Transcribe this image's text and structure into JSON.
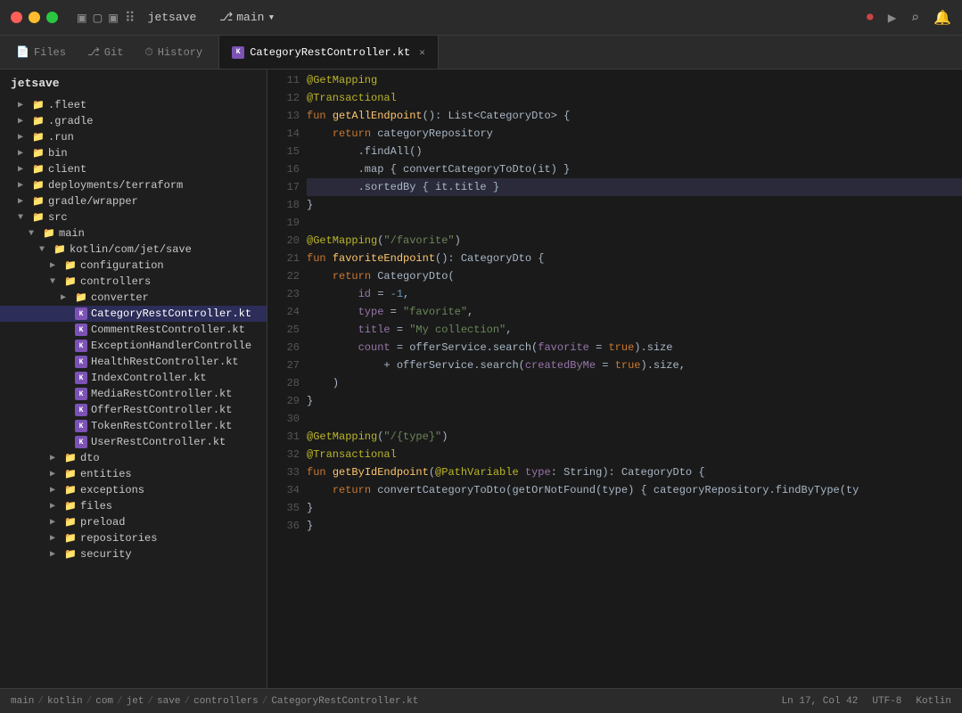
{
  "titlebar": {
    "app_name": "jetsave",
    "branch_icon": "⎇",
    "branch_name": "main",
    "branch_chevron": "▾",
    "icons": [
      "▣",
      "▢",
      "⊞",
      "⠿"
    ],
    "right_icons": {
      "record": "⏺",
      "run": "▶",
      "search": "⌕",
      "bell": "🔔"
    }
  },
  "tabs": {
    "nav": [
      {
        "label": "Files",
        "icon": "📄"
      },
      {
        "label": "Git",
        "icon": "⎇"
      },
      {
        "label": "History",
        "icon": "⏱"
      }
    ],
    "files": [
      {
        "label": "CategoryRestController.kt",
        "active": true
      }
    ]
  },
  "sidebar": {
    "project_name": "jetsave",
    "tree": [
      {
        "label": ".fleet",
        "indent": 1,
        "type": "folder",
        "chevron": "▶",
        "expanded": false
      },
      {
        "label": ".gradle",
        "indent": 1,
        "type": "folder",
        "chevron": "▶",
        "expanded": false
      },
      {
        "label": ".run",
        "indent": 1,
        "type": "folder",
        "chevron": "▶",
        "expanded": false
      },
      {
        "label": "bin",
        "indent": 1,
        "type": "folder",
        "chevron": "▶",
        "expanded": false
      },
      {
        "label": "client",
        "indent": 1,
        "type": "folder",
        "chevron": "▶",
        "expanded": false
      },
      {
        "label": "deployments/terraform",
        "indent": 1,
        "type": "folder",
        "chevron": "▶",
        "expanded": false
      },
      {
        "label": "gradle/wrapper",
        "indent": 1,
        "type": "folder",
        "chevron": "▶",
        "expanded": false
      },
      {
        "label": "src",
        "indent": 1,
        "type": "folder",
        "chevron": "▼",
        "expanded": true
      },
      {
        "label": "main",
        "indent": 2,
        "type": "folder",
        "chevron": "▼",
        "expanded": true
      },
      {
        "label": "kotlin/com/jet/save",
        "indent": 3,
        "type": "folder",
        "chevron": "▼",
        "expanded": true
      },
      {
        "label": "configuration",
        "indent": 4,
        "type": "folder",
        "chevron": "▶",
        "expanded": false
      },
      {
        "label": "controllers",
        "indent": 4,
        "type": "folder",
        "chevron": "▼",
        "expanded": true
      },
      {
        "label": "converter",
        "indent": 5,
        "type": "folder",
        "chevron": "▶",
        "expanded": false
      },
      {
        "label": "CategoryRestController.kt",
        "indent": 5,
        "type": "kt",
        "active": true
      },
      {
        "label": "CommentRestController.kt",
        "indent": 5,
        "type": "kt"
      },
      {
        "label": "ExceptionHandlerController",
        "indent": 5,
        "type": "kt"
      },
      {
        "label": "HealthRestController.kt",
        "indent": 5,
        "type": "kt"
      },
      {
        "label": "IndexController.kt",
        "indent": 5,
        "type": "kt"
      },
      {
        "label": "MediaRestController.kt",
        "indent": 5,
        "type": "kt"
      },
      {
        "label": "OfferRestController.kt",
        "indent": 5,
        "type": "kt"
      },
      {
        "label": "TokenRestController.kt",
        "indent": 5,
        "type": "kt"
      },
      {
        "label": "UserRestController.kt",
        "indent": 5,
        "type": "kt"
      },
      {
        "label": "dto",
        "indent": 4,
        "type": "folder",
        "chevron": "▶",
        "expanded": false
      },
      {
        "label": "entities",
        "indent": 4,
        "type": "folder",
        "chevron": "▶",
        "expanded": false
      },
      {
        "label": "exceptions",
        "indent": 4,
        "type": "folder",
        "chevron": "▶",
        "expanded": false
      },
      {
        "label": "files",
        "indent": 4,
        "type": "folder",
        "chevron": "▶",
        "expanded": false
      },
      {
        "label": "preload",
        "indent": 4,
        "type": "folder",
        "chevron": "▶",
        "expanded": false
      },
      {
        "label": "repositories",
        "indent": 4,
        "type": "folder",
        "chevron": "▶",
        "expanded": false
      },
      {
        "label": "security",
        "indent": 4,
        "type": "folder",
        "chevron": "▶",
        "expanded": false
      }
    ]
  },
  "code": {
    "filename": "CategoryRestController.kt",
    "lines": [
      {
        "num": 11,
        "content": "@GetMapping"
      },
      {
        "num": 12,
        "content": "@Transactional"
      },
      {
        "num": 13,
        "content": "fun getAllEndpoint(): List<CategoryDto> {"
      },
      {
        "num": 14,
        "content": "    return categoryRepository"
      },
      {
        "num": 15,
        "content": "        .findAll()"
      },
      {
        "num": 16,
        "content": "        .map { convertCategoryToDto(it) }"
      },
      {
        "num": 17,
        "content": "        .sortedBy { it.title }",
        "highlighted": true
      },
      {
        "num": 18,
        "content": "}"
      },
      {
        "num": 19,
        "content": ""
      },
      {
        "num": 20,
        "content": "@GetMapping(\"/favorite\")"
      },
      {
        "num": 21,
        "content": "fun favoriteEndpoint(): CategoryDto {"
      },
      {
        "num": 22,
        "content": "    return CategoryDto("
      },
      {
        "num": 23,
        "content": "        id = -1,"
      },
      {
        "num": 24,
        "content": "        type = \"favorite\","
      },
      {
        "num": 25,
        "content": "        title = \"My collection\","
      },
      {
        "num": 26,
        "content": "        count = offerService.search(favorite = true).size"
      },
      {
        "num": 27,
        "content": "            + offerService.search(createdByMe = true).size,"
      },
      {
        "num": 28,
        "content": "    )"
      },
      {
        "num": 29,
        "content": "}"
      },
      {
        "num": 30,
        "content": ""
      },
      {
        "num": 31,
        "content": "@GetMapping(\"/{type}\")"
      },
      {
        "num": 32,
        "content": "@Transactional"
      },
      {
        "num": 33,
        "content": "fun getByIdEndpoint(@PathVariable type: String): CategoryDto {"
      },
      {
        "num": 34,
        "content": "    return convertCategoryToDto(getOrNotFound(type) { categoryRepository.findByType(ty"
      },
      {
        "num": 35,
        "content": "}"
      },
      {
        "num": 36,
        "content": "}"
      }
    ]
  },
  "statusbar": {
    "breadcrumb": [
      "main",
      "kotlin",
      "com",
      "jet",
      "save",
      "controllers",
      "CategoryRestController.kt"
    ],
    "position": "Ln 17, Col 42",
    "encoding": "UTF-8",
    "language": "Kotlin"
  }
}
